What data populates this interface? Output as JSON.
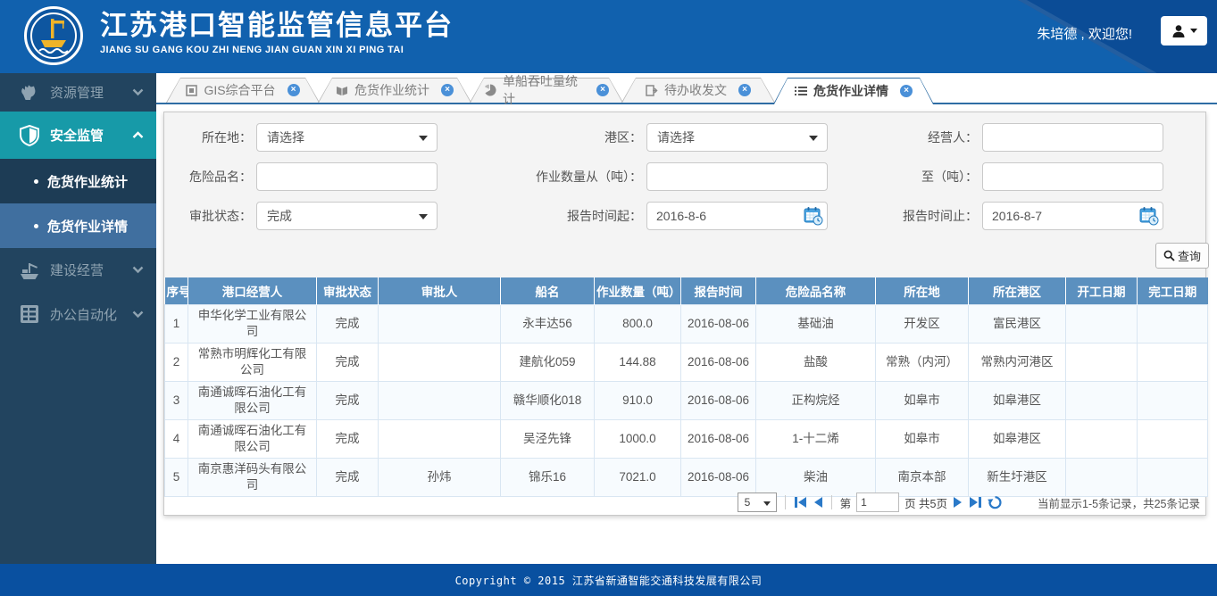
{
  "header": {
    "title": "江苏港口智能监管信息平台",
    "subtitle": "JIANG SU GANG KOU ZHI NENG JIAN GUAN XIN XI PING TAI",
    "welcome": "朱培德 , 欢迎您!"
  },
  "sidebar": {
    "items": [
      {
        "label": "资源管理",
        "icon": "resource-icon",
        "state": "collapsed"
      },
      {
        "label": "安全监管",
        "icon": "shield-icon",
        "state": "expanded",
        "active": true
      },
      {
        "label": "危货作业统计",
        "type": "submenu"
      },
      {
        "label": "危货作业详情",
        "type": "submenu",
        "selected": true
      },
      {
        "label": "建设经营",
        "icon": "ship-crane-icon",
        "state": "collapsed"
      },
      {
        "label": "办公自动化",
        "icon": "office-grid-icon",
        "state": "collapsed"
      }
    ]
  },
  "tabs": [
    {
      "label": "GIS综合平台",
      "icon": "gis-icon",
      "active": false
    },
    {
      "label": "危货作业统计",
      "icon": "book-icon",
      "active": false
    },
    {
      "label": "单船吞吐量统计",
      "icon": "pie-chart-icon",
      "active": false
    },
    {
      "label": "待办收发文",
      "icon": "document-export-icon",
      "active": false
    },
    {
      "label": "危货作业详情",
      "icon": "list-icon",
      "active": true
    }
  ],
  "filter": {
    "fields": [
      {
        "label": "所在地：",
        "type": "select",
        "value": "请选择"
      },
      {
        "label": "港区：",
        "type": "select",
        "value": "请选择"
      },
      {
        "label": "经营人：",
        "type": "text",
        "value": ""
      },
      {
        "label": "危险品名：",
        "type": "text",
        "value": ""
      },
      {
        "label": "作业数量从（吨）：",
        "type": "text",
        "value": ""
      },
      {
        "label": "至（吨）：",
        "type": "text",
        "value": ""
      },
      {
        "label": "审批状态：",
        "type": "select",
        "value": "完成"
      },
      {
        "label": "报告时间起：",
        "type": "date",
        "value": "2016-8-6"
      },
      {
        "label": "报告时间止：",
        "type": "date",
        "value": "2016-8-7"
      }
    ],
    "search_label": "查询"
  },
  "table": {
    "columns": [
      "序号",
      "港口经营人",
      "审批状态",
      "审批人",
      "船名",
      "作业数量（吨）",
      "报告时间",
      "危险品名称",
      "所在地",
      "所在港区",
      "开工日期",
      "完工日期"
    ],
    "rows": [
      [
        "1",
        "申华化学工业有限公司",
        "完成",
        "",
        "永丰达56",
        "800.0",
        "2016-08-06",
        "基础油",
        "开发区",
        "富民港区",
        "",
        ""
      ],
      [
        "2",
        "常熟市明辉化工有限公司",
        "完成",
        "",
        "建航化059",
        "144.88",
        "2016-08-06",
        "盐酸",
        "常熟（内河）",
        "常熟内河港区",
        "",
        ""
      ],
      [
        "3",
        "南通诚晖石油化工有限公司",
        "完成",
        "",
        "赣华顺化018",
        "910.0",
        "2016-08-06",
        "正构烷烃",
        "如皋市",
        "如皋港区",
        "",
        ""
      ],
      [
        "4",
        "南通诚晖石油化工有限公司",
        "完成",
        "",
        "吴泾先锋",
        "1000.0",
        "2016-08-06",
        "1-十二烯",
        "如皋市",
        "如皋港区",
        "",
        ""
      ],
      [
        "5",
        "南京惠洋码头有限公司",
        "完成",
        "孙炜",
        "锦乐16",
        "7021.0",
        "2016-08-06",
        "柴油",
        "南京本部",
        "新生圩港区",
        "",
        ""
      ]
    ]
  },
  "pagination": {
    "page_size": "5",
    "page_prefix": "第",
    "current_page": "1",
    "page_suffix": "页 共5页",
    "summary": "当前显示1-5条记录，共25条记录"
  },
  "footer": {
    "copyright": "Copyright © 2015 江苏省新通智能交通科技发展有限公司"
  },
  "colors": {
    "header_blue": "#1161ae",
    "header_dark_blue": "#0b4c96",
    "sidebar_navy": "#22445f",
    "active_menu_teal": "#179aa8",
    "selected_submenu_blue": "#406f9f",
    "table_header_blue": "#5b90bf",
    "tab_underline_blue": "#2e6da4",
    "pager_icon_blue": "#2a79c8",
    "footer_blue": "#0950a0"
  }
}
